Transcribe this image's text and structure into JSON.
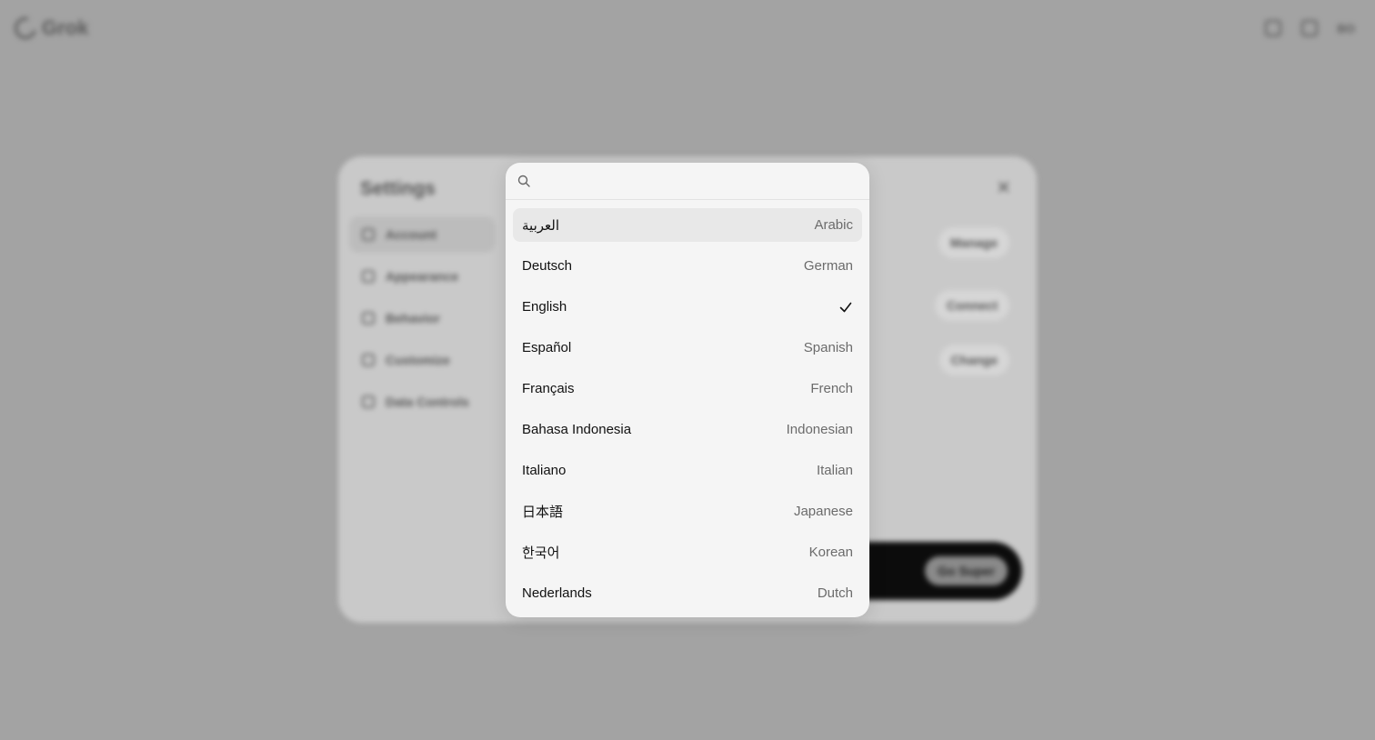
{
  "app": {
    "name": "Grok",
    "avatar_initials": "BO"
  },
  "settings": {
    "title": "Settings",
    "nav": [
      {
        "label": "Account",
        "icon": "user-icon"
      },
      {
        "label": "Appearance",
        "icon": "palette-icon"
      },
      {
        "label": "Behavior",
        "icon": "behavior-icon"
      },
      {
        "label": "Customize",
        "icon": "sliders-icon"
      },
      {
        "label": "Data Controls",
        "icon": "database-icon"
      }
    ],
    "buttons": {
      "manage": "Manage",
      "connect": "Connect",
      "change": "Change",
      "go_super": "Go Super"
    }
  },
  "language_picker": {
    "search_value": "",
    "selected": "English",
    "items": [
      {
        "native": "العربية",
        "english": "Arabic"
      },
      {
        "native": "Deutsch",
        "english": "German"
      },
      {
        "native": "English",
        "english": ""
      },
      {
        "native": "Español",
        "english": "Spanish"
      },
      {
        "native": "Français",
        "english": "French"
      },
      {
        "native": "Bahasa Indonesia",
        "english": "Indonesian"
      },
      {
        "native": "Italiano",
        "english": "Italian"
      },
      {
        "native": "日本語",
        "english": "Japanese"
      },
      {
        "native": "한국어",
        "english": "Korean"
      },
      {
        "native": "Nederlands",
        "english": "Dutch"
      }
    ]
  }
}
